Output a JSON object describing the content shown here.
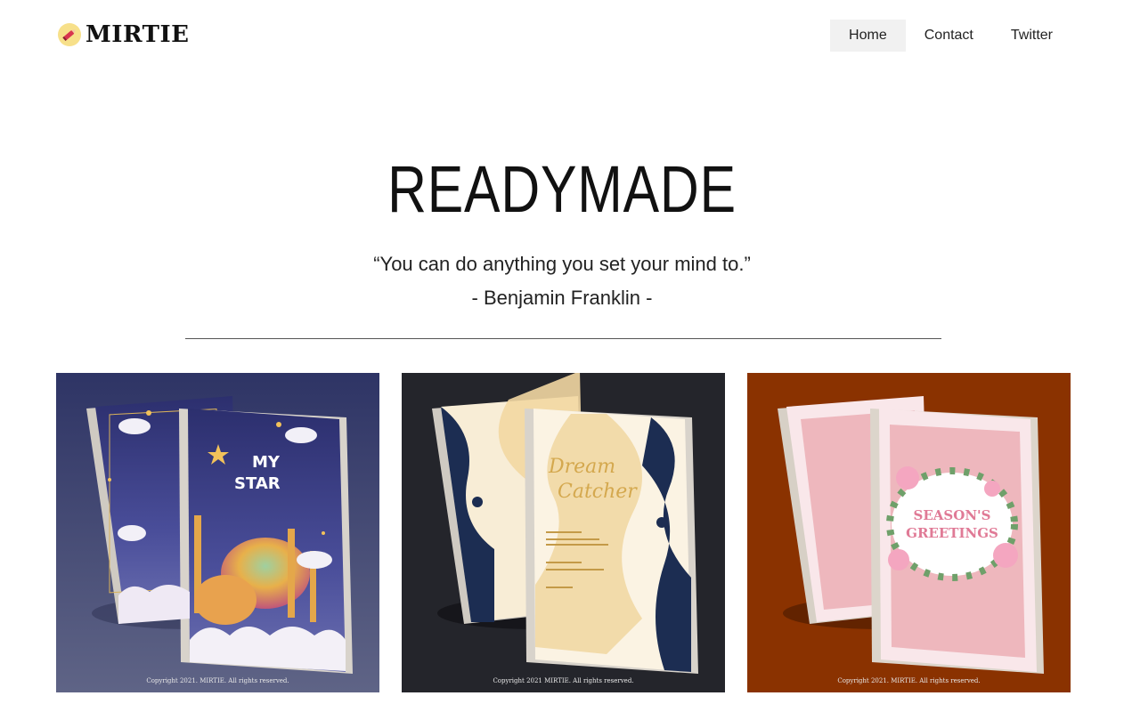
{
  "brand": {
    "name": "MIRTIE",
    "logo_icon": "pencil-circle-icon",
    "logo_color": "#f7e08a"
  },
  "nav": {
    "items": [
      {
        "label": "Home",
        "active": true
      },
      {
        "label": "Contact",
        "active": false
      },
      {
        "label": "Twitter",
        "active": false
      }
    ]
  },
  "hero": {
    "title": "READYMADE",
    "quote": "“You can do anything you set your mind to.”",
    "author": "- Benjamin Franklin -"
  },
  "gallery": {
    "cards": [
      {
        "cover_title_1": "MY",
        "cover_title_2": "STAR",
        "copyright": "Copyright 2021. MIRTIE. All rights reserved.",
        "background": "#3a4370"
      },
      {
        "cover_title_1": "Dream",
        "cover_title_2": "Catcher",
        "copyright": "Copyright 2021 MIRTIE. All rights reserved.",
        "background": "#222328"
      },
      {
        "cover_title_1": "SEASON'S",
        "cover_title_2": "GREETINGS",
        "copyright": "Copyright 2021. MIRTIE. All rights reserved.",
        "background": "#8a3200"
      }
    ]
  }
}
